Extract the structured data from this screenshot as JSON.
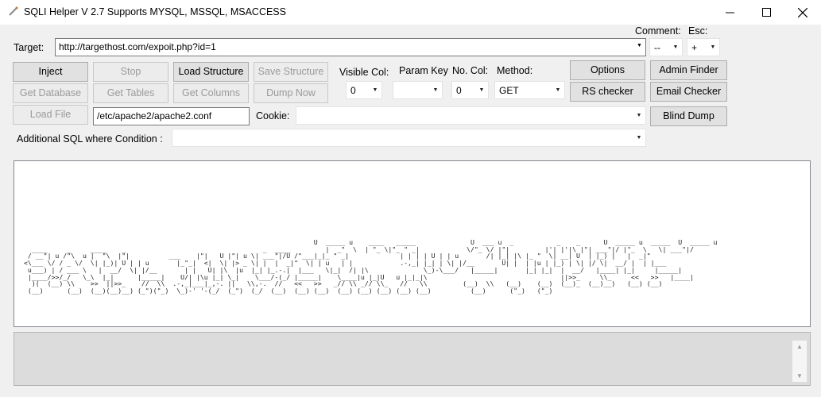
{
  "window": {
    "title": "SQLI Helper V 2.7 Supports MYSQL, MSSQL, MSACCESS",
    "minimize": "—",
    "maximize": "☐",
    "close": "✕"
  },
  "target": {
    "label": "Target:",
    "value": "http://targethost.com/expoit.php?id=1"
  },
  "comment": {
    "label": "Comment:",
    "value": "--"
  },
  "esc": {
    "label": "Esc:",
    "value": "+"
  },
  "buttons": {
    "inject": "Inject",
    "stop": "Stop",
    "load_structure": "Load Structure",
    "save_structure": "Save Structure",
    "get_database": "Get Database",
    "get_tables": "Get Tables",
    "get_columns": "Get Columns",
    "dump_now": "Dump Now",
    "load_file": "Load File",
    "options": "Options",
    "admin_finder": "Admin Finder",
    "rs_checker": "RS checker",
    "email_checker": "Email Checker",
    "blind_dump": "Blind Dump"
  },
  "visible_col": {
    "label": "Visible Col:",
    "value": "0"
  },
  "param_key": {
    "label": "Param Key",
    "value": ""
  },
  "no_col": {
    "label": "No. Col:",
    "value": "0"
  },
  "method": {
    "label": "Method:",
    "value": "GET"
  },
  "file_path": {
    "value": "/etc/apache2/apache2.conf"
  },
  "cookie": {
    "label": "Cookie:",
    "value": ""
  },
  "additional_sql": {
    "label": "Additional SQL where Condition :",
    "value": ""
  },
  "ascii_banner": "                                                                          U  _____ u    ____   _____              U  ___ u  _           _    _      U  _____ u  _____  U  _____ u\n  ____     _     ____    _                                   _  ____         |  _\"  \\  | \"_ \\|\"_ \" _|            \\/\"_ \\/ |\"|         |'| |'|\\ |\"| ___\"|/ |\"_  \\   \\| ___\"|/\n / __\"| u /\"\\  u |  \"\\  |\"|          ___    |\"|   U |\"| u \\| ___\"|/U /\"___|_|_ \" _|             | | | | U | | u       /| |_| |\\ |_ \"  \\| __| U  | |_) |   |  _|\"\n<\\___ \\/ / _ \\/  \\| |_)| U | | u       |_\"_|  <|  \\| |> _ \\| |  |  _|\"  \\| | u   | |            .-,_| |_| | \\| |/__       U| |  | |u | |_) | \\| |/ \\|  __/ |  | |___\n u___) | / ___ \\   |  __/  \\| |/__       | |   U| |\\  |u  |_| |_.-.|  |___   \\|_|  /| |\\              \\_)-\\___/   |_____|       |_| |_|  |  __/   |____| |_|     |_____|\n |____/>>/_/   \\_\\  |_|      |_____|    U/| |\\u |_| \\_|    \\___/-(_/ |_____|    \\____|u |_|U   u |_|_|\\                                  ||>>_     \\\\_     <<   >>   |____|\n  )(  (__) \\\\    >>  ||>>_    //  \\\\  .-,_|___|_,-. ||   \\\\,-.  //   <<   >>   _// \\\\ _// \\\\_   //   \\\\         (__)  \\\\   (__)    (__)  (__)_  (__)__)   (__) (__)\n (__)      (__)  (__)(__)__) (_\")(\"_)  \\_)-' '-(_/  (_\")  (_/  (__)  (__) (__)  (__) (__) (__) (__) (__)          (__)      (\"_)   (\"_)",
  "status_text": ""
}
